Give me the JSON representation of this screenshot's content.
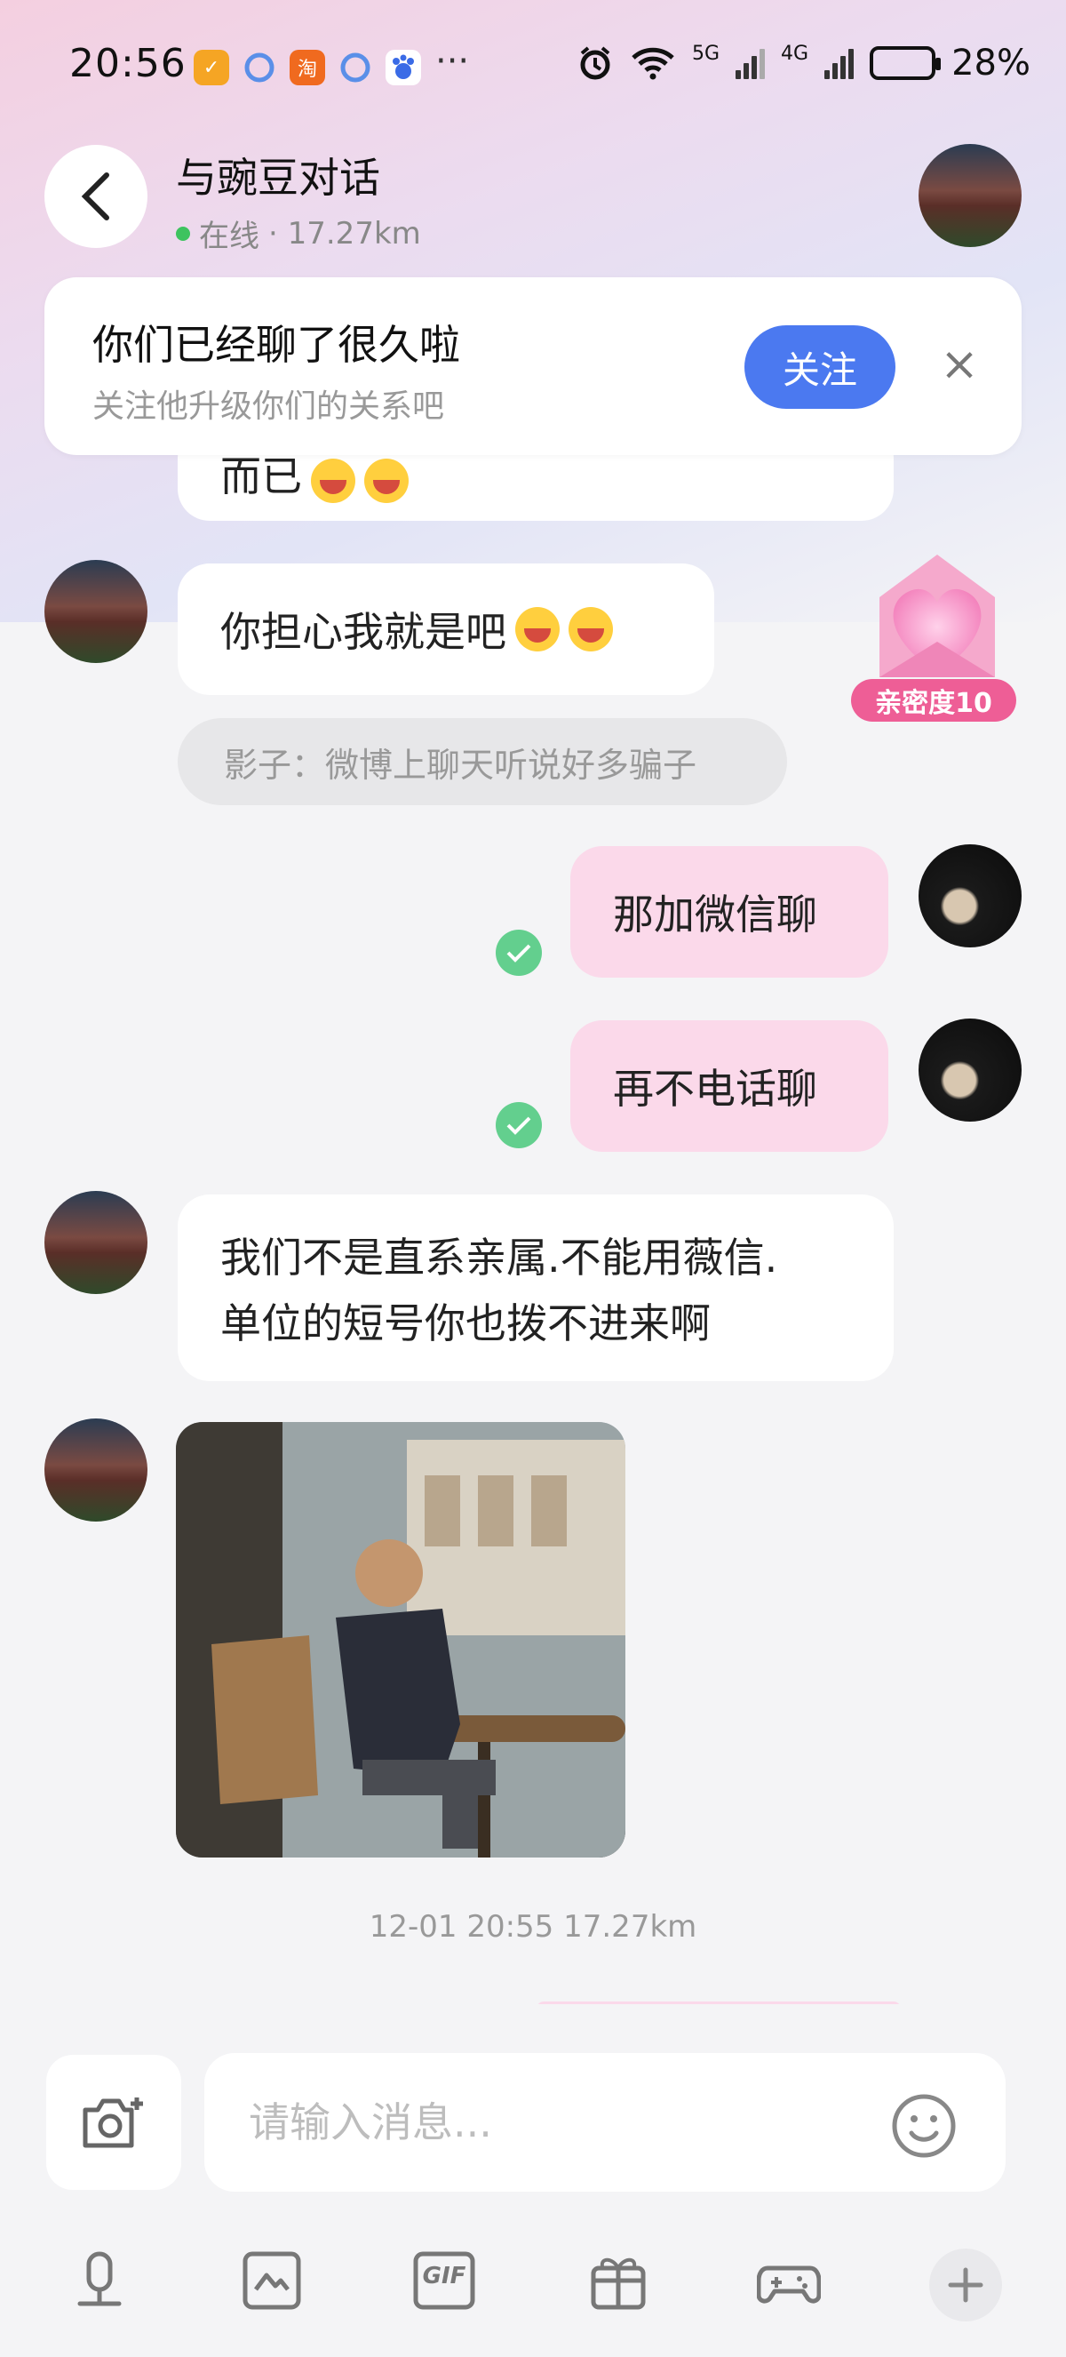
{
  "status_bar": {
    "time": "20:56",
    "apps": [
      "淘"
    ],
    "dots": "···",
    "net_a": "5G",
    "net_b": "4G",
    "battery": "28%"
  },
  "header": {
    "title": "与豌豆对话",
    "online": "在线",
    "distance": "· 17.27km"
  },
  "follow_card": {
    "title": "你们已经聊了很久啦",
    "subtitle": "关注他升级你们的关系吧",
    "button": "关注"
  },
  "messages": {
    "partial_top": "而已",
    "msg1": "你担心我就是吧",
    "notice": "影子：微博上聊天听说好多骗子",
    "mine1": "那加微信聊",
    "mine2": "再不电话聊",
    "msg2_line1": "我们不是直系亲属.不能用薇信.",
    "msg2_line2": "单位的短号你也拨不进来啊"
  },
  "intimacy": {
    "label": "亲密度10"
  },
  "timestamp": {
    "text": "12-01 20:55  17.27km"
  },
  "input": {
    "placeholder": "请输入消息..."
  },
  "toolbar": {
    "gif": "GIF"
  },
  "colors": {
    "accent": "#4b79f0",
    "my_bubble": "#fbd9ea",
    "check": "#63cf8e",
    "badge": "#ee5e96"
  }
}
